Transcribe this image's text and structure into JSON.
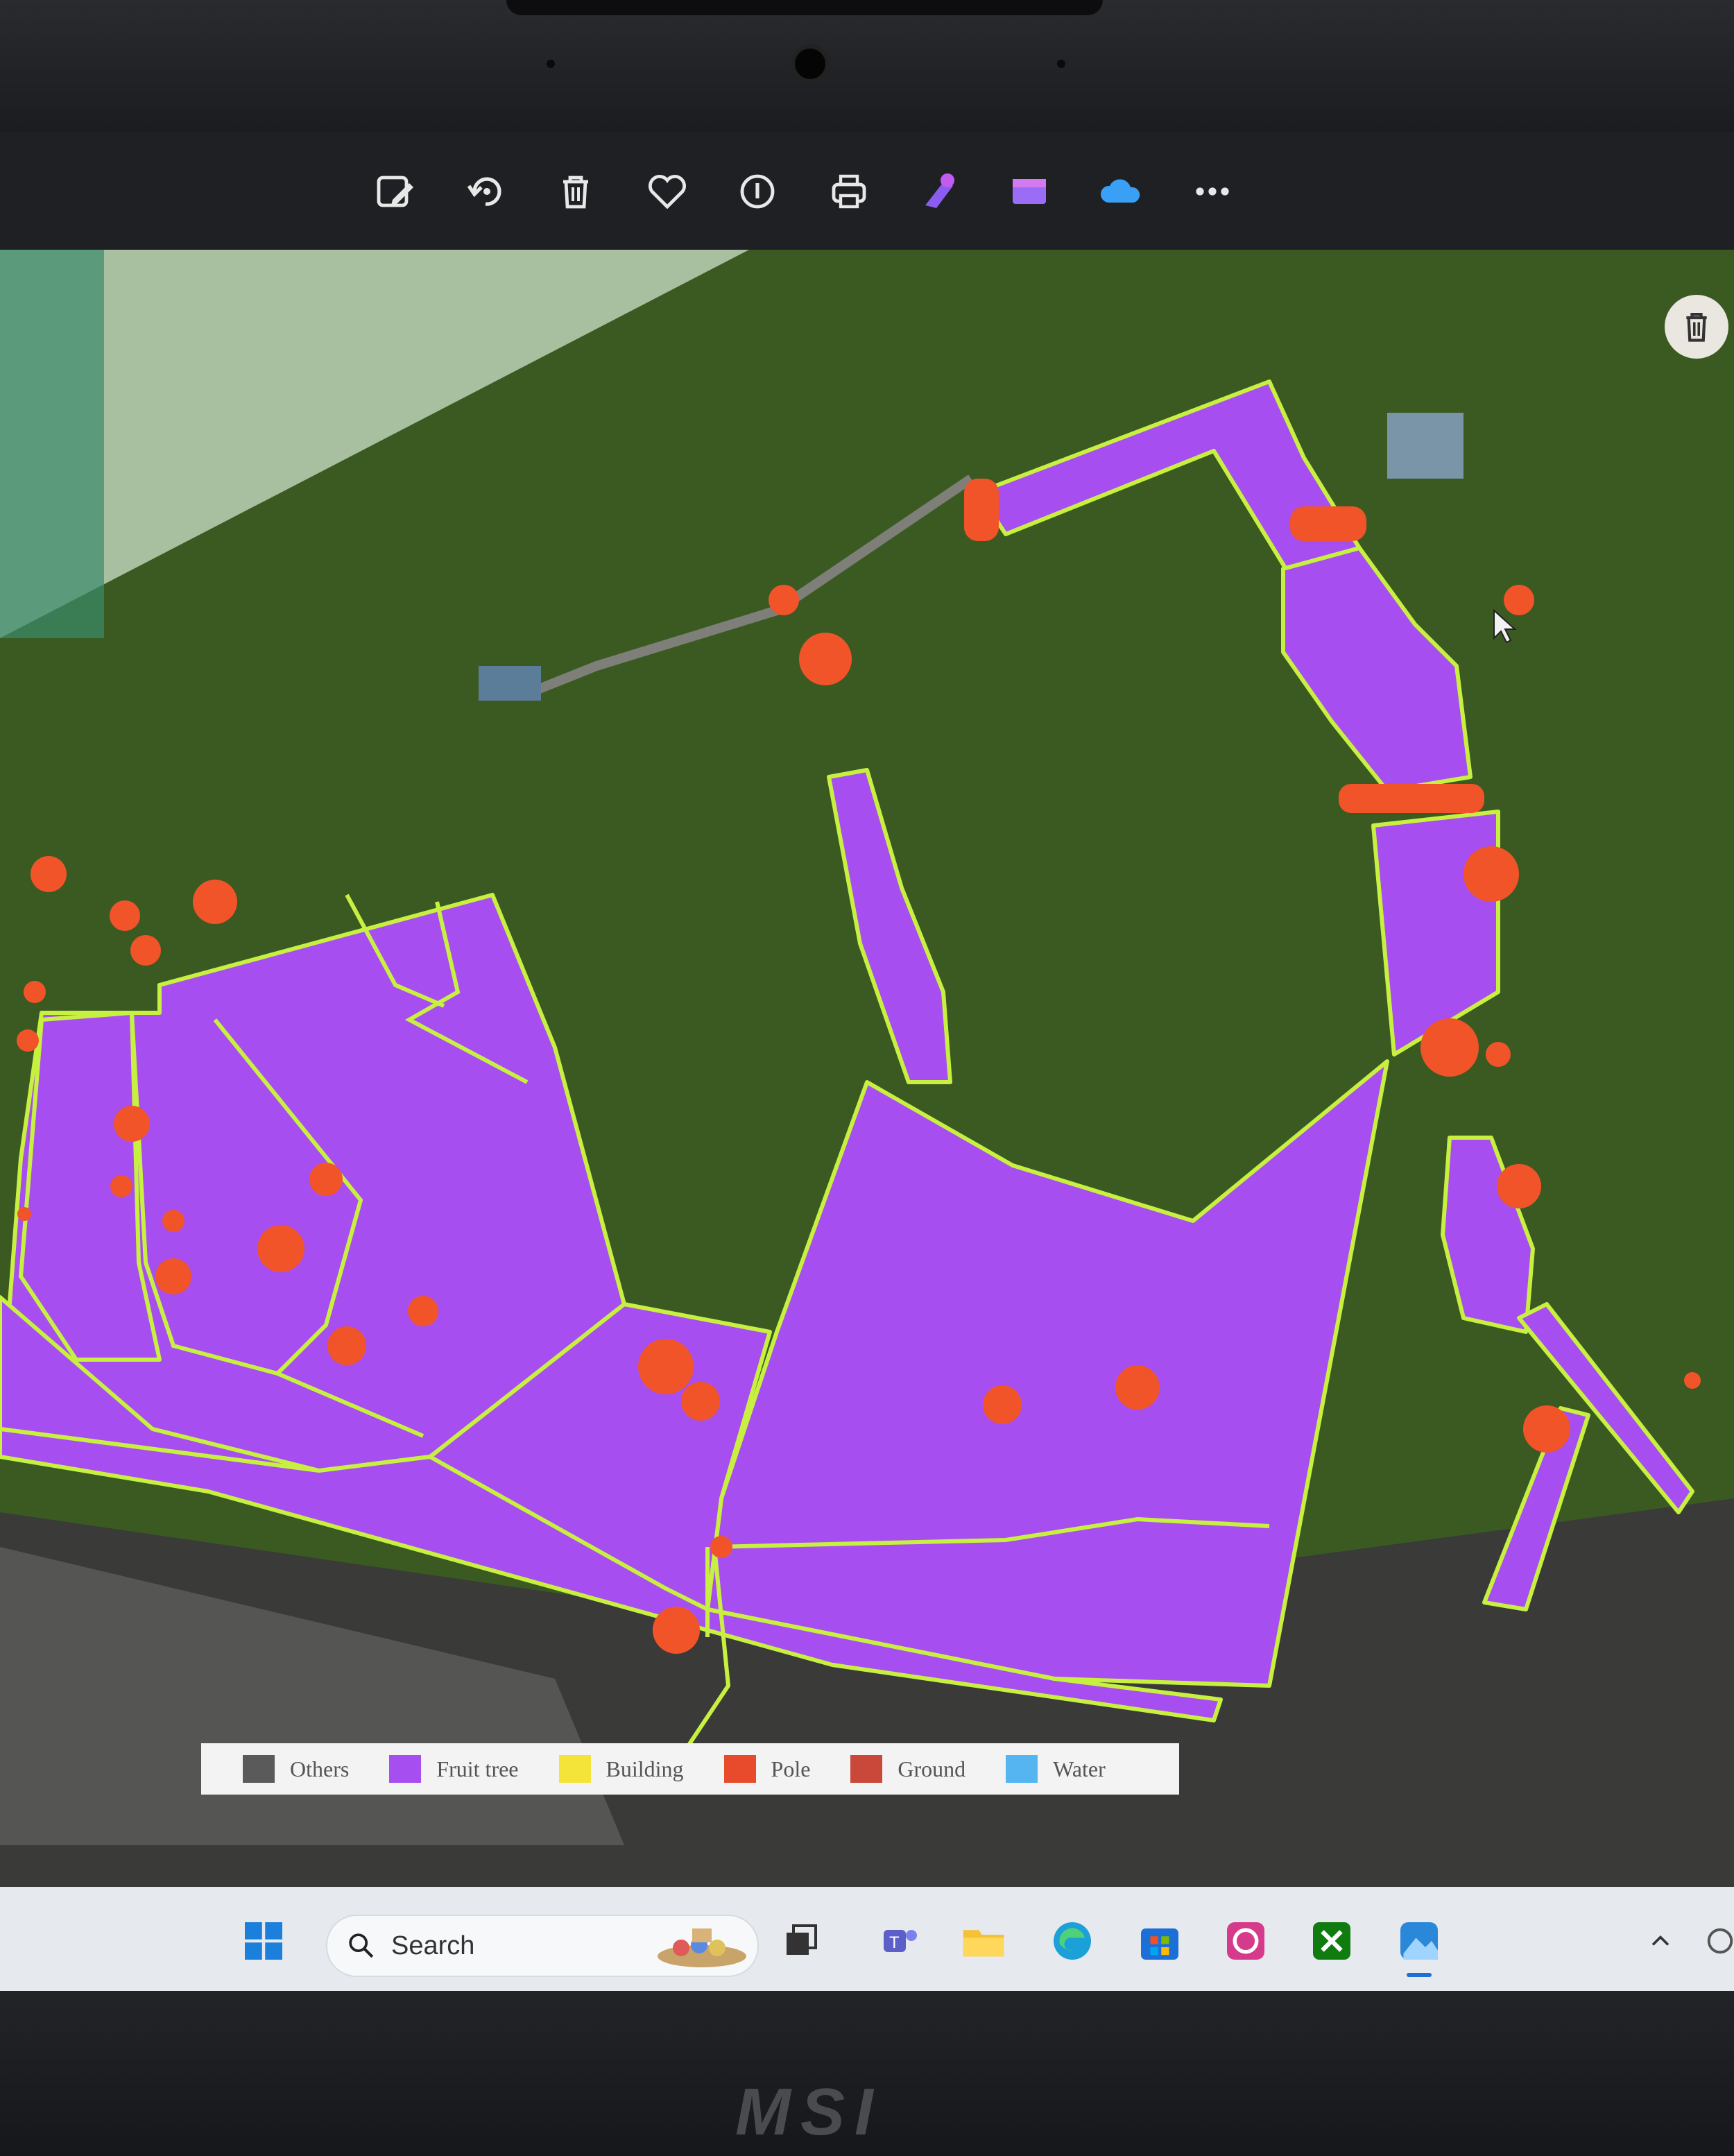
{
  "toolbar": {
    "icons": [
      "edit-image-icon",
      "rotate-icon",
      "delete-icon",
      "favorite-heart-icon",
      "info-icon",
      "print-icon",
      "designer-icon",
      "clipchamp-icon",
      "onedrive-icon",
      "more-icon"
    ]
  },
  "legend": {
    "items": [
      {
        "label": "Others",
        "color": "#5a5a5a"
      },
      {
        "label": "Fruit tree",
        "color": "#a64ef0"
      },
      {
        "label": "Building",
        "color": "#f4e43a"
      },
      {
        "label": "Pole",
        "color": "#e84a2c"
      },
      {
        "label": "Ground",
        "color": "#c9483a"
      },
      {
        "label": "Water",
        "color": "#55b5f0"
      }
    ]
  },
  "taskbar": {
    "search_placeholder": "Search",
    "apps": [
      "start-icon",
      "task-view-icon",
      "teams-icon",
      "file-explorer-icon",
      "edge-icon",
      "store-icon",
      "camera-app-icon",
      "xbox-icon",
      "photos-icon"
    ]
  },
  "device": {
    "brand": "MSI"
  },
  "colors": {
    "segment_fill": "#a64ef0",
    "segment_outline": "#c8f040",
    "pole": "#f2542a",
    "grass": "#3f5e22"
  }
}
